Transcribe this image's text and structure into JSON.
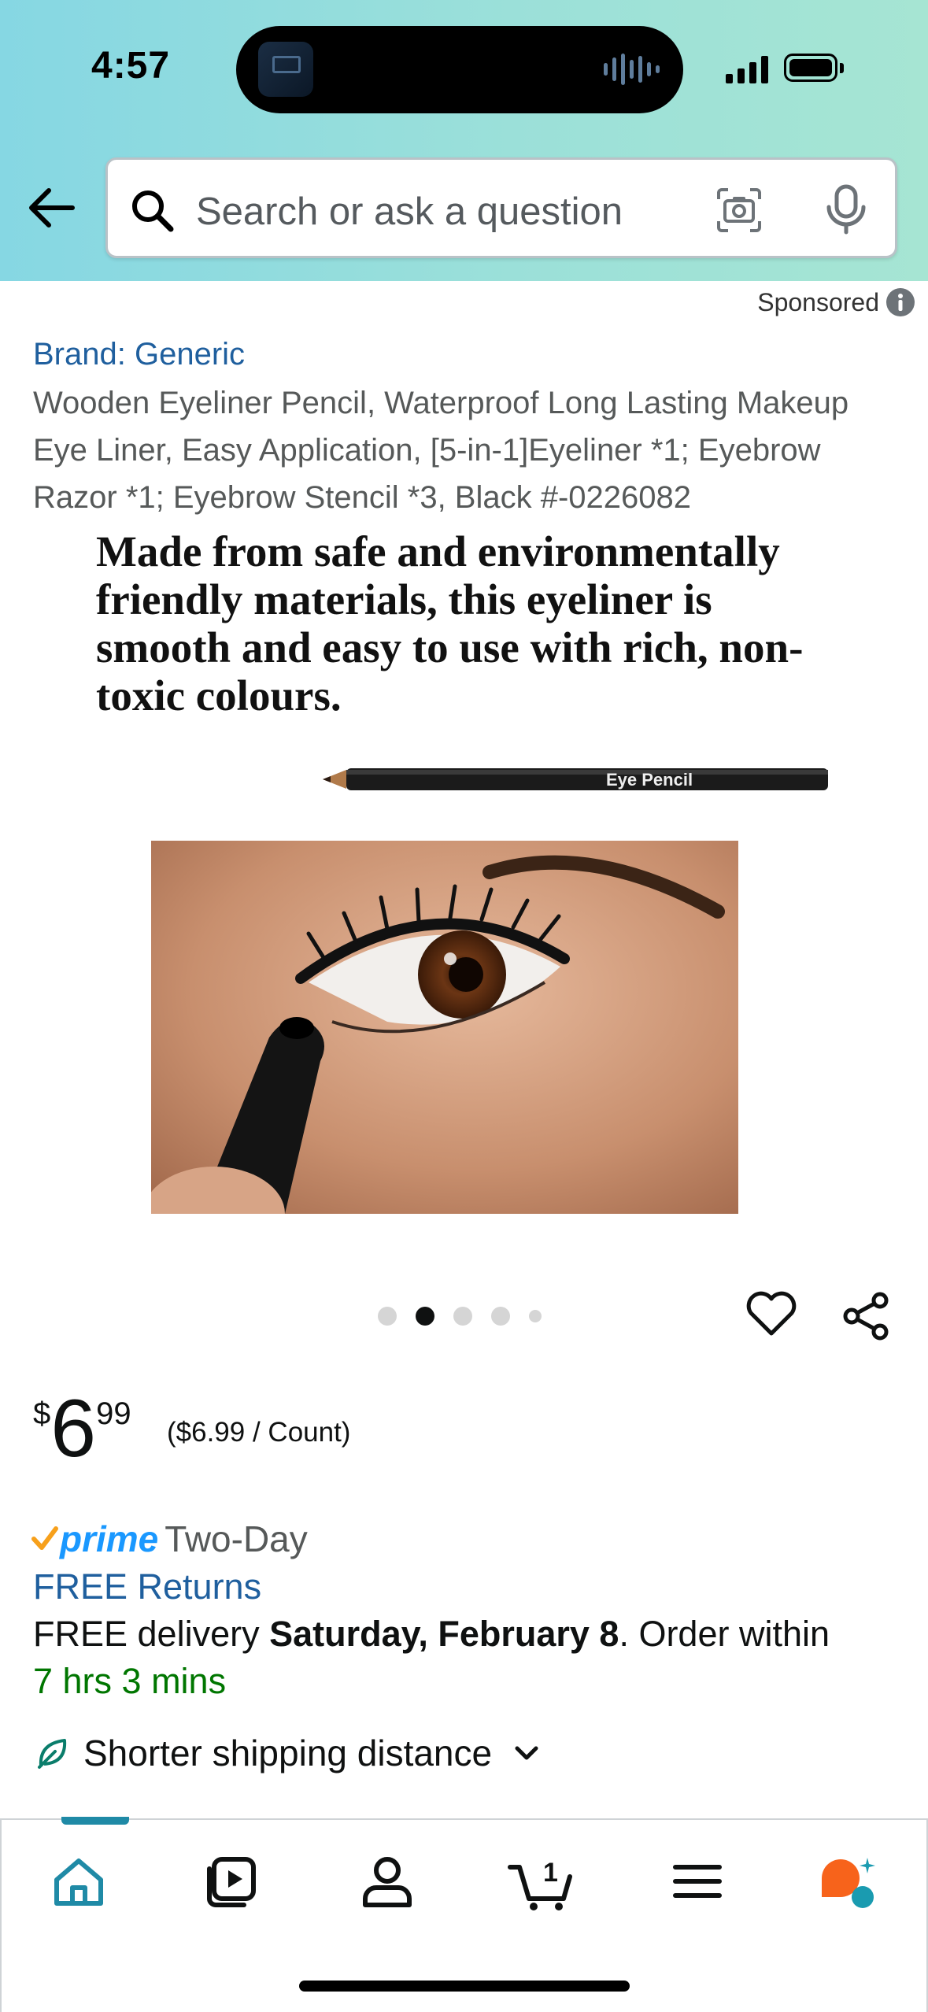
{
  "status_bar": {
    "time": "4:57"
  },
  "search": {
    "placeholder": "Search or ask a question"
  },
  "sponsored_label": "Sponsored",
  "product": {
    "brand": "Brand: Generic",
    "title": "Wooden Eyeliner Pencil, Waterproof Long Lasting Makeup Eye Liner, Easy Application, [5-in-1]Eyeliner *1; Eyebrow Razor *1; Eyebrow Stencil *3, Black #-0226082",
    "image_caption": "Made from safe and environmentally friendly materials, this eyeliner is smooth and easy to use with rich, non-toxic colours.",
    "pencil_label": "Eye Pencil",
    "carousel": {
      "total": 5,
      "active_index": 1
    }
  },
  "price": {
    "symbol": "$",
    "whole": "6",
    "fraction": "99",
    "unit_price": "($6.99 / Count)"
  },
  "delivery": {
    "prime_word": "prime",
    "prime_type": "Two-Day",
    "free_returns": "FREE Returns",
    "delivery_prefix": "FREE delivery ",
    "delivery_date": "Saturday, February 8",
    "delivery_suffix": ". Order within",
    "countdown": "7 hrs 3 mins",
    "shipping_note": "Shorter shipping distance"
  },
  "tab_bar": {
    "tabs": [
      {
        "name": "home",
        "icon": "home-icon",
        "active": true
      },
      {
        "name": "video",
        "icon": "video-icon",
        "active": false
      },
      {
        "name": "account",
        "icon": "person-icon",
        "active": false
      },
      {
        "name": "cart",
        "icon": "cart-icon",
        "active": false,
        "badge": "1"
      },
      {
        "name": "menu",
        "icon": "menu-icon",
        "active": false
      },
      {
        "name": "rufus",
        "icon": "rufus-icon",
        "active": false
      }
    ]
  },
  "colors": {
    "link": "#1f5f9e",
    "prime_blue": "#1a98ff",
    "countdown_green": "#007600",
    "accent_teal": "#1f8aa6",
    "rufus_orange": "#f7631b"
  }
}
